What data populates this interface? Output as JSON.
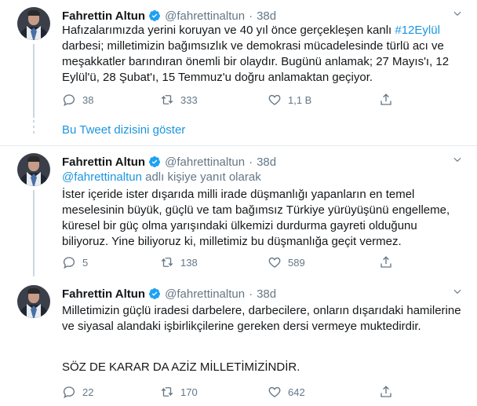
{
  "colors": {
    "link": "#1b95e0",
    "muted": "#657786",
    "text": "#14171a",
    "divider": "#e6ecf0"
  },
  "tweets": [
    {
      "name": "Fahrettin Altun",
      "handle": "@fahrettinaltun",
      "dot": "·",
      "time": "38d",
      "text_a": "Hafızalarımızda yerini koruyan ve 40 yıl önce gerçekleşen kanlı ",
      "hashtag": "#12Eylül",
      "text_b": " darbesi; milletimizin bağımsızlık ve demokrasi mücadelesinde türlü acı ve meşakkatler barındıran önemli bir olaydır. Bugünü anlamak; 27 Mayıs'ı, 12 Eylül'ü, 28 Şubat'ı, 15 Temmuz'u doğru anlamaktan geçiyor.",
      "replies": "38",
      "retweets": "333",
      "likes": "1,1 B"
    },
    {
      "name": "Fahrettin Altun",
      "handle": "@fahrettinaltun",
      "dot": "·",
      "time": "38d",
      "reply_handle": "@fahrettinaltun",
      "reply_suffix": " adlı kişiye yanıt olarak",
      "text": "İster içeride ister dışarıda milli irade düşmanlığı yapanların en temel meselesinin büyük, güçlü ve tam bağımsız Türkiye yürüyüşünü engelleme, küresel bir güç olma yarışındaki ülkemizi durdurma gayreti olduğunu biliyoruz. Yine biliyoruz ki, milletimiz bu düşmanlığa geçit vermez.",
      "replies": "5",
      "retweets": "138",
      "likes": "589"
    },
    {
      "name": "Fahrettin Altun",
      "handle": "@fahrettinaltun",
      "dot": "·",
      "time": "38d",
      "text": "Milletimizin güçlü iradesi darbelere, darbecilere, onların dışarıdaki hamilerine ve siyasal alandaki işbirlikçilerine gereken dersi vermeye muktedirdir.",
      "text2": "SÖZ DE KARAR DA AZİZ MİLLETİMİZİNDİR.",
      "replies": "22",
      "retweets": "170",
      "likes": "642"
    }
  ],
  "show_thread": "Bu Tweet dizisini göster"
}
